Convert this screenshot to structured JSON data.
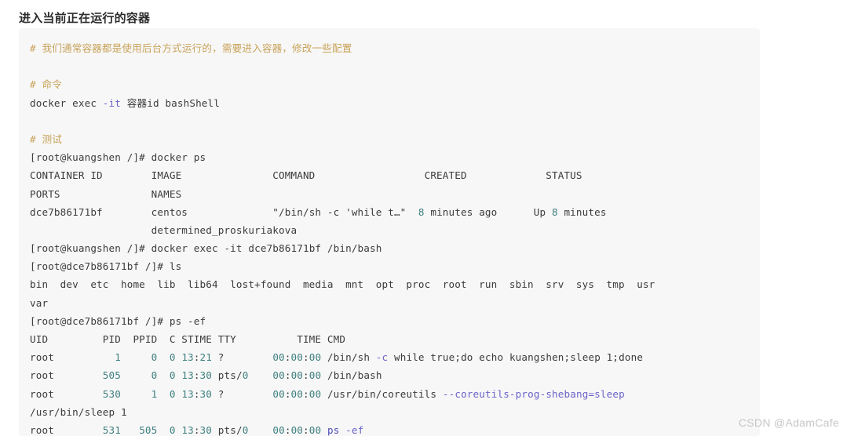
{
  "page": {
    "title": "进入当前正在运行的容器",
    "watermark": "CSDN @AdamCafe",
    "colors": {
      "code_background": "#f7f7f7",
      "comment": "#c8a35a",
      "command": "#d8a145",
      "flag": "#6b63c9",
      "keyword": "#7b5fc4",
      "string": "#b5535a",
      "number": "#3f7f7f",
      "plain": "#3b3b3b",
      "watermark": "#c6c6c6",
      "title": "#2c2c2c"
    }
  },
  "code_block": {
    "language": "shell",
    "lines": [
      {
        "id": "l01",
        "tokens": [
          {
            "t": "# 我们通常容器都是使用后台方式运行的，需要进入容器，修改一些配置",
            "c": "comment"
          }
        ]
      },
      {
        "id": "l02",
        "tokens": []
      },
      {
        "id": "l03",
        "tokens": [
          {
            "t": "# 命令",
            "c": "comment"
          }
        ]
      },
      {
        "id": "l04",
        "tokens": [
          {
            "t": "docker exec ",
            "c": "plain"
          },
          {
            "t": "-it",
            "c": "flag"
          },
          {
            "t": " 容器id bashShell",
            "c": "plain"
          }
        ]
      },
      {
        "id": "l05",
        "tokens": []
      },
      {
        "id": "l06",
        "tokens": [
          {
            "t": "# 测试",
            "c": "comment"
          }
        ]
      },
      {
        "id": "l07",
        "tokens": [
          {
            "t": "[root@kuangshen /]# ",
            "c": "plain"
          },
          {
            "t": "docker ps",
            "c": "command"
          }
        ]
      },
      {
        "id": "l08",
        "tokens": [
          {
            "t": "CONTAINER ID        IMAGE               COMMAND                  CREATED             STATUS",
            "c": "plain"
          }
        ]
      },
      {
        "id": "l09",
        "tokens": [
          {
            "t": "PORTS               NAMES",
            "c": "plain"
          }
        ]
      },
      {
        "id": "l10",
        "tokens": [
          {
            "t": "dce7b86171bf        centos              ",
            "c": "plain"
          },
          {
            "t": "\"/bin/sh -c 'while t…\"",
            "c": "string"
          },
          {
            "t": "  ",
            "c": "plain"
          },
          {
            "t": "8",
            "c": "num"
          },
          {
            "t": " minutes ago      Up ",
            "c": "plain"
          },
          {
            "t": "8",
            "c": "num"
          },
          {
            "t": " minutes",
            "c": "plain"
          }
        ]
      },
      {
        "id": "l11",
        "tokens": [
          {
            "t": "                    determined_proskuriakova",
            "c": "plain"
          }
        ]
      },
      {
        "id": "l12",
        "tokens": [
          {
            "t": "[root@kuangshen /]# ",
            "c": "plain"
          },
          {
            "t": "docker exec -it dce7b86171bf /bin/bash",
            "c": "command"
          }
        ]
      },
      {
        "id": "l13",
        "tokens": [
          {
            "t": "[root@dce7b86171bf /]# ",
            "c": "plain"
          },
          {
            "t": "ls",
            "c": "command"
          }
        ]
      },
      {
        "id": "l14",
        "tokens": [
          {
            "t": "bin  dev  etc  home  lib  lib64  lost+found  media  mnt  opt  proc  root  run  sbin  srv  sys  tmp  usr",
            "c": "plain"
          }
        ]
      },
      {
        "id": "l15",
        "tokens": [
          {
            "t": "var",
            "c": "plain"
          }
        ]
      },
      {
        "id": "l16",
        "tokens": [
          {
            "t": "[root@dce7b86171bf /]# ",
            "c": "plain"
          },
          {
            "t": "ps -ef",
            "c": "command"
          }
        ]
      },
      {
        "id": "l17",
        "tokens": [
          {
            "t": "UID         PID  PPID  C STIME TTY          TIME CMD",
            "c": "plain"
          }
        ]
      },
      {
        "id": "l18",
        "tokens": [
          {
            "t": "root          ",
            "c": "plain"
          },
          {
            "t": "1",
            "c": "num"
          },
          {
            "t": "     ",
            "c": "plain"
          },
          {
            "t": "0",
            "c": "num"
          },
          {
            "t": "  ",
            "c": "plain"
          },
          {
            "t": "0",
            "c": "num"
          },
          {
            "t": " ",
            "c": "plain"
          },
          {
            "t": "13",
            "c": "num"
          },
          {
            "t": ":",
            "c": "plain"
          },
          {
            "t": "21",
            "c": "num"
          },
          {
            "t": " ?        ",
            "c": "plain"
          },
          {
            "t": "00",
            "c": "num"
          },
          {
            "t": ":",
            "c": "plain"
          },
          {
            "t": "00",
            "c": "num"
          },
          {
            "t": ":",
            "c": "plain"
          },
          {
            "t": "00",
            "c": "num"
          },
          {
            "t": " /bin/sh ",
            "c": "plain"
          },
          {
            "t": "-c",
            "c": "flag"
          },
          {
            "t": " ",
            "c": "plain"
          },
          {
            "t": "while",
            "c": "keyword"
          },
          {
            "t": " ",
            "c": "plain"
          },
          {
            "t": "true",
            "c": "keyword"
          },
          {
            "t": ";do ",
            "c": "plain"
          },
          {
            "t": "echo",
            "c": "keyword"
          },
          {
            "t": " kuangshen;sleep ",
            "c": "plain"
          },
          {
            "t": "1",
            "c": "plain"
          },
          {
            "t": ";done",
            "c": "plain"
          }
        ]
      },
      {
        "id": "l19",
        "tokens": [
          {
            "t": "root        ",
            "c": "plain"
          },
          {
            "t": "505",
            "c": "num"
          },
          {
            "t": "     ",
            "c": "plain"
          },
          {
            "t": "0",
            "c": "num"
          },
          {
            "t": "  ",
            "c": "plain"
          },
          {
            "t": "0",
            "c": "num"
          },
          {
            "t": " ",
            "c": "plain"
          },
          {
            "t": "13",
            "c": "num"
          },
          {
            "t": ":",
            "c": "plain"
          },
          {
            "t": "30",
            "c": "num"
          },
          {
            "t": " pts/",
            "c": "plain"
          },
          {
            "t": "0",
            "c": "num"
          },
          {
            "t": "    ",
            "c": "plain"
          },
          {
            "t": "00",
            "c": "num"
          },
          {
            "t": ":",
            "c": "plain"
          },
          {
            "t": "00",
            "c": "num"
          },
          {
            "t": ":",
            "c": "plain"
          },
          {
            "t": "00",
            "c": "num"
          },
          {
            "t": " /bin/bash",
            "c": "plain"
          }
        ]
      },
      {
        "id": "l20",
        "tokens": [
          {
            "t": "root        ",
            "c": "plain"
          },
          {
            "t": "530",
            "c": "num"
          },
          {
            "t": "     ",
            "c": "plain"
          },
          {
            "t": "1",
            "c": "num"
          },
          {
            "t": "  ",
            "c": "plain"
          },
          {
            "t": "0",
            "c": "num"
          },
          {
            "t": " ",
            "c": "plain"
          },
          {
            "t": "13",
            "c": "num"
          },
          {
            "t": ":",
            "c": "plain"
          },
          {
            "t": "30",
            "c": "num"
          },
          {
            "t": " ?        ",
            "c": "plain"
          },
          {
            "t": "00",
            "c": "num"
          },
          {
            "t": ":",
            "c": "plain"
          },
          {
            "t": "00",
            "c": "num"
          },
          {
            "t": ":",
            "c": "plain"
          },
          {
            "t": "00",
            "c": "num"
          },
          {
            "t": " /usr/bin/coreutils ",
            "c": "plain"
          },
          {
            "t": "--coreutils-prog-shebang=sleep",
            "c": "flag"
          }
        ]
      },
      {
        "id": "l21",
        "tokens": [
          {
            "t": "/usr/bin/sleep ",
            "c": "plain"
          },
          {
            "t": "1",
            "c": "plain"
          }
        ]
      },
      {
        "id": "l22",
        "tokens": [
          {
            "t": "root        ",
            "c": "plain"
          },
          {
            "t": "531",
            "c": "num"
          },
          {
            "t": "   ",
            "c": "plain"
          },
          {
            "t": "505",
            "c": "num"
          },
          {
            "t": "  ",
            "c": "plain"
          },
          {
            "t": "0",
            "c": "num"
          },
          {
            "t": " ",
            "c": "plain"
          },
          {
            "t": "13",
            "c": "num"
          },
          {
            "t": ":",
            "c": "plain"
          },
          {
            "t": "30",
            "c": "num"
          },
          {
            "t": " pts/",
            "c": "plain"
          },
          {
            "t": "0",
            "c": "num"
          },
          {
            "t": "    ",
            "c": "plain"
          },
          {
            "t": "00",
            "c": "num"
          },
          {
            "t": ":",
            "c": "plain"
          },
          {
            "t": "00",
            "c": "num"
          },
          {
            "t": ":",
            "c": "plain"
          },
          {
            "t": "00",
            "c": "num"
          },
          {
            "t": " ",
            "c": "plain"
          },
          {
            "t": "ps",
            "c": "ps"
          },
          {
            "t": " ",
            "c": "plain"
          },
          {
            "t": "-ef",
            "c": "flag"
          }
        ]
      }
    ]
  }
}
